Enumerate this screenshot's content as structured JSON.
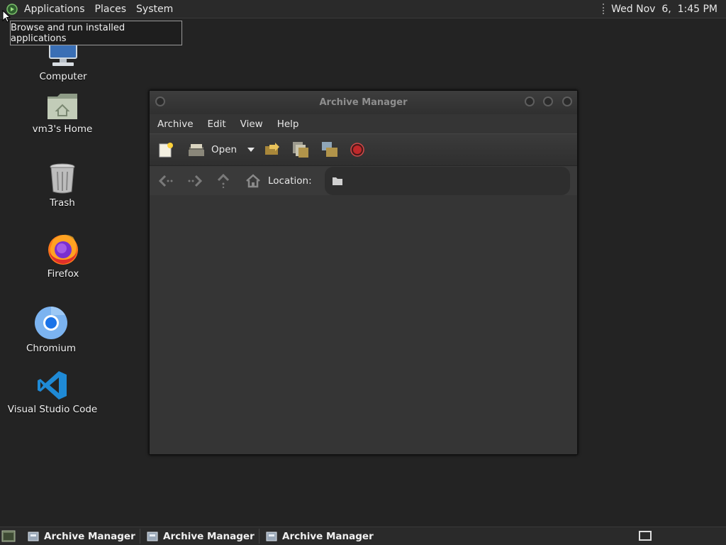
{
  "top_panel": {
    "menus": [
      "Applications",
      "Places",
      "System"
    ],
    "clock": "Wed Nov  6,  1:45 PM"
  },
  "tooltip": {
    "text": "Browse and run installed applications"
  },
  "desktop": {
    "icons": [
      {
        "label": "Computer",
        "icon": "computer-icon"
      },
      {
        "label": "vm3's Home",
        "icon": "home-folder-icon"
      },
      {
        "label": "Trash",
        "icon": "trash-icon"
      },
      {
        "label": "Firefox",
        "icon": "firefox-icon"
      },
      {
        "label": "Chromium",
        "icon": "chromium-icon"
      },
      {
        "label": "Visual Studio Code",
        "icon": "vscode-icon"
      }
    ]
  },
  "window": {
    "title": "Archive Manager",
    "menu": [
      "Archive",
      "Edit",
      "View",
      "Help"
    ],
    "toolbar": {
      "open_label": "Open",
      "buttons": [
        "new-archive-icon",
        "open-archive-icon",
        "open-dropdown-icon",
        "extract-icon",
        "add-files-icon",
        "add-folder-icon",
        "stop-icon"
      ]
    },
    "location": {
      "label": "Location:",
      "value": ""
    }
  },
  "taskbar": {
    "tasks": [
      "Archive Manager",
      "Archive Manager",
      "Archive Manager"
    ]
  },
  "colors": {
    "panel_bg": "#2a2a2a",
    "desktop_bg": "#232323",
    "window_bg": "#353535",
    "stop_red": "#c0282a"
  }
}
